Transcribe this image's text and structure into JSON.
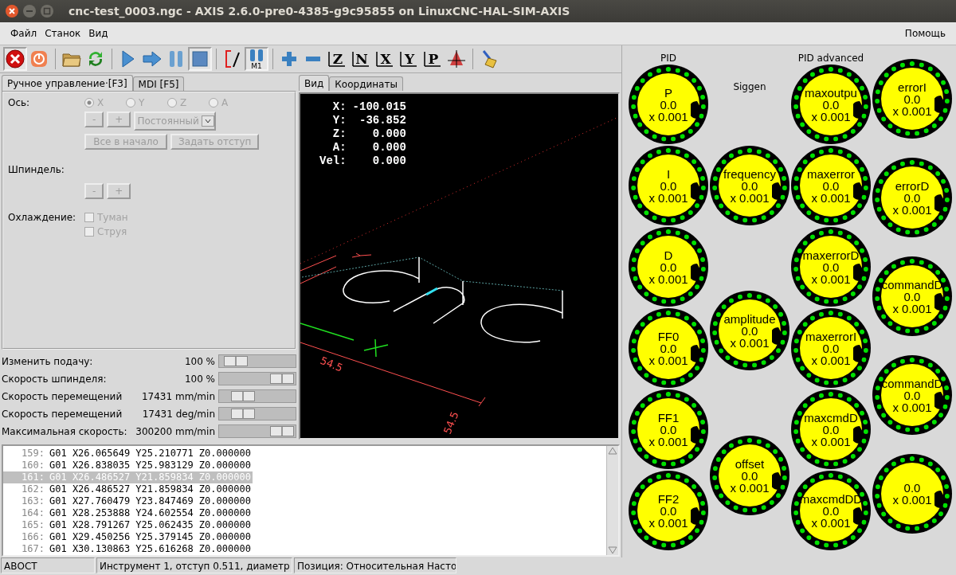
{
  "window": {
    "title": "cnc-test_0003.ngc - AXIS 2.6.0-pre0-4385-g9c95855 on LinuxCNC-HAL-SIM-AXIS"
  },
  "menu": {
    "left": [
      "Файл",
      "Станок",
      "Вид"
    ],
    "right": [
      "Помощь"
    ]
  },
  "toolbar": [
    [
      {
        "kind": "estop",
        "pressed": true
      },
      {
        "kind": "power",
        "pressed": false
      }
    ],
    [
      {
        "kind": "open",
        "pressed": false
      },
      {
        "kind": "reload",
        "pressed": false
      }
    ],
    [
      {
        "kind": "run",
        "pressed": false
      },
      {
        "kind": "step",
        "pressed": false
      },
      {
        "kind": "pause",
        "pressed": false
      },
      {
        "kind": "stop",
        "pressed": true
      }
    ],
    [
      {
        "kind": "blockdelete",
        "pressed": false
      },
      {
        "kind": "optionalstop",
        "label": "M1",
        "pressed": true
      }
    ],
    [
      {
        "kind": "zoomin",
        "pressed": false
      },
      {
        "kind": "zoomout",
        "pressed": false
      },
      {
        "kind": "view",
        "label": "Z",
        "pressed": false
      },
      {
        "kind": "view",
        "label": "N",
        "pressed": false
      },
      {
        "kind": "view",
        "label": "X",
        "pressed": false
      },
      {
        "kind": "view",
        "label": "Y",
        "pressed": false
      },
      {
        "kind": "view",
        "label": "P",
        "pressed": false
      },
      {
        "kind": "perspective",
        "pressed": false
      }
    ],
    [
      {
        "kind": "clear",
        "pressed": false
      }
    ]
  ],
  "control_tabs": [
    {
      "label": "Ручное управление·[F3]",
      "selected": true
    },
    {
      "label": "MDI [F5]",
      "selected": false
    }
  ],
  "manual": {
    "axis_label": "Ось:",
    "axes": [
      {
        "label": "X",
        "selected": true,
        "disabled": true
      },
      {
        "label": "Y",
        "selected": false,
        "disabled": true
      },
      {
        "label": "Z",
        "selected": false,
        "disabled": true
      },
      {
        "label": "A",
        "selected": false,
        "disabled": true
      }
    ],
    "jog_buttons": [
      {
        "label": "-",
        "disabled": true
      },
      {
        "label": "+",
        "disabled": true
      }
    ],
    "jog_mode": {
      "value": "Постоянный",
      "disabled": true
    },
    "action_buttons": [
      {
        "label": "Все в начало",
        "disabled": true
      },
      {
        "label": "Задать отступ",
        "disabled": true
      }
    ],
    "spindle_label": "Шпиндель:",
    "spindle_buttons": [
      {
        "label": "-",
        "disabled": true
      },
      {
        "label": "+",
        "disabled": true
      }
    ],
    "coolant_label": "Охлаждение:",
    "coolant": [
      {
        "label": "Туман",
        "checked": false,
        "disabled": true
      },
      {
        "label": "Струя",
        "checked": false,
        "disabled": true
      }
    ]
  },
  "overrides": [
    {
      "label": "Изменить подачу:",
      "reading": "100 %",
      "level": 0.09
    },
    {
      "label": "Скорость шпинделя:",
      "reading": "100 %",
      "level": 0.97
    },
    {
      "label": "Скорость перемещений",
      "reading": "17431 mm/min",
      "level": 0.22
    },
    {
      "label": "Скорость перемещений",
      "reading": "17431 deg/min",
      "level": 0.22
    },
    {
      "label": "Максимальная скорость:",
      "reading": "300200 mm/min",
      "level": 0.97
    }
  ],
  "view_tabs": [
    {
      "label": "Вид",
      "selected": true
    },
    {
      "label": "Координаты",
      "selected": false
    }
  ],
  "dro": [
    {
      "axis": "X:",
      "value": "-100.015"
    },
    {
      "axis": "Y:",
      "value": "-36.852"
    },
    {
      "axis": "Z:",
      "value": "0.000"
    },
    {
      "axis": "A:",
      "value": "0.000"
    },
    {
      "axis": "Vel:",
      "value": "0.000"
    }
  ],
  "dimension_labels": [
    "54.5",
    "54.5"
  ],
  "gcode": [
    {
      "number": "159:",
      "code": "G01 X26.065649 Y25.210771 Z0.000000",
      "selected": false
    },
    {
      "number": "160:",
      "code": "G01 X26.838035 Y25.983129 Z0.000000",
      "selected": false
    },
    {
      "number": "161:",
      "code": "G01 X26.486527 Y21.859834 Z0.000000",
      "selected": true
    },
    {
      "number": "162:",
      "code": "G01 X26.486527 Y21.859834 Z0.000000",
      "selected": false
    },
    {
      "number": "163:",
      "code": "G01 X27.760479 Y23.847469 Z0.000000",
      "selected": false
    },
    {
      "number": "164:",
      "code": "G01 X28.253888 Y24.602554 Z0.000000",
      "selected": false
    },
    {
      "number": "165:",
      "code": "G01 X28.791267 Y25.062435 Z0.000000",
      "selected": false
    },
    {
      "number": "166:",
      "code": "G01 X29.450256 Y25.379145 Z0.000000",
      "selected": false
    },
    {
      "number": "167:",
      "code": "G01 X30.130863 Y25.616268 Z0.000000",
      "selected": false
    }
  ],
  "status_bar": [
    "АВОСТ",
    "Инструмент 1, отступ 0.511, диаметр",
    "Позиция: Относительная Насто"
  ],
  "dial_columns": [
    {
      "header": "PID",
      "dials": [
        {
          "label": "P",
          "value": "0.0",
          "scale": "x 0.001"
        },
        {
          "label": "I",
          "value": "0.0",
          "scale": "x 0.001"
        },
        {
          "label": "D",
          "value": "0.0",
          "scale": "x 0.001"
        },
        {
          "label": "FF0",
          "value": "0.0",
          "scale": "x 0.001"
        },
        {
          "label": "FF1",
          "value": "0.0",
          "scale": "x 0.001"
        },
        {
          "label": "FF2",
          "value": "0.0",
          "scale": "x 0.001"
        }
      ]
    },
    {
      "header": "Siggen",
      "dials": [
        {
          "label": "frequency",
          "value": "0.0",
          "scale": "x 0.001"
        },
        {
          "label": "amplitude",
          "value": "0.0",
          "scale": "x 0.001"
        },
        {
          "label": "offset",
          "value": "0.0",
          "scale": "x 0.001"
        }
      ]
    },
    {
      "header": "PID advanced",
      "dials": [
        {
          "label": "maxoutpu",
          "value": "0.0",
          "scale": "x 0.001"
        },
        {
          "label": "maxerror",
          "value": "0.0",
          "scale": "x 0.001"
        },
        {
          "label": "maxerrorD",
          "value": "0.0",
          "scale": "x 0.001"
        },
        {
          "label": "maxerrorI",
          "value": "0.0",
          "scale": "x 0.001"
        },
        {
          "label": "maxcmdD",
          "value": "0.0",
          "scale": "x 0.001"
        },
        {
          "label": "maxcmdDD",
          "value": "0.0",
          "scale": "x 0.001"
        }
      ]
    },
    {
      "dials": [
        {
          "label": "errorI",
          "value": "0.0",
          "scale": "x 0.001"
        },
        {
          "label": "errorD",
          "value": "0.0",
          "scale": "x 0.001"
        },
        {
          "label": "commandD",
          "value": "0.0",
          "scale": "x 0.001"
        },
        {
          "label": "commandD",
          "value": "0.0",
          "scale": "x 0.001"
        },
        {
          "value": "0.0",
          "scale": "x 0.001"
        }
      ]
    }
  ]
}
